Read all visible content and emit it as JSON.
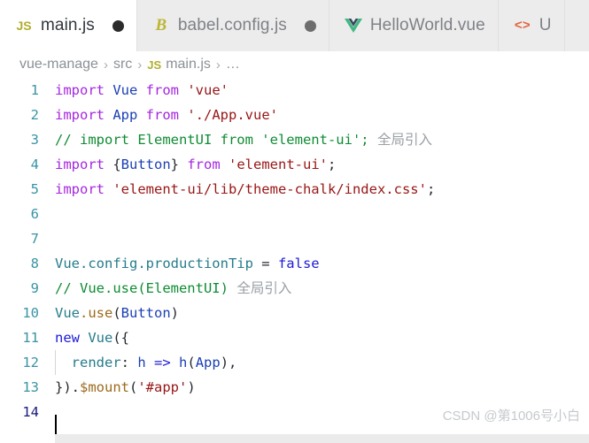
{
  "window": {
    "app": "visual-studio-code-editor",
    "active_file": "main.js"
  },
  "tabs": [
    {
      "label": "main.js",
      "icon": "js-file-icon",
      "icon_glyph": "JS",
      "active": true,
      "modified": true,
      "dot": "●"
    },
    {
      "label": "babel.config.js",
      "icon": "babel-file-icon",
      "icon_glyph": "B",
      "active": false,
      "modified": true,
      "dot": "●"
    },
    {
      "label": "HelloWorld.vue",
      "icon": "vue-file-icon",
      "icon_glyph": "V",
      "active": false,
      "modified": false,
      "dot": ""
    },
    {
      "label": "U",
      "icon": "html-file-icon",
      "icon_glyph": "<>",
      "active": false,
      "modified": false,
      "dot": ""
    }
  ],
  "breadcrumb": {
    "separator": "›",
    "items": [
      {
        "label": "vue-manage",
        "icon": ""
      },
      {
        "label": "src",
        "icon": ""
      },
      {
        "label": "main.js",
        "icon": "JS"
      },
      {
        "label": "…",
        "icon": ""
      }
    ]
  },
  "code": {
    "language": "javascript",
    "lines": [
      {
        "number": "1",
        "tokens": [
          {
            "text": "import ",
            "cls": "t-kw"
          },
          {
            "text": "Vue ",
            "cls": "t-id"
          },
          {
            "text": "from ",
            "cls": "t-kw"
          },
          {
            "text": "'vue'",
            "cls": "t-str"
          }
        ]
      },
      {
        "number": "2",
        "tokens": [
          {
            "text": "import ",
            "cls": "t-kw"
          },
          {
            "text": "App ",
            "cls": "t-id"
          },
          {
            "text": "from ",
            "cls": "t-kw"
          },
          {
            "text": "'./App.vue'",
            "cls": "t-str"
          }
        ]
      },
      {
        "number": "3",
        "tokens": [
          {
            "text": "// import ElementUI from 'element-ui'; ",
            "cls": "t-cmt"
          },
          {
            "text": "全局引入",
            "cls": "t-cmt-cn"
          }
        ]
      },
      {
        "number": "4",
        "tokens": [
          {
            "text": "import ",
            "cls": "t-kw"
          },
          {
            "text": "{",
            "cls": "t-punc"
          },
          {
            "text": "Button",
            "cls": "t-id"
          },
          {
            "text": "} ",
            "cls": "t-punc"
          },
          {
            "text": "from ",
            "cls": "t-kw"
          },
          {
            "text": "'element-ui'",
            "cls": "t-str"
          },
          {
            "text": ";",
            "cls": "t-punc"
          }
        ]
      },
      {
        "number": "5",
        "tokens": [
          {
            "text": "import ",
            "cls": "t-kw"
          },
          {
            "text": "'element-ui/lib/theme-chalk/index.css'",
            "cls": "t-str"
          },
          {
            "text": ";",
            "cls": "t-punc"
          }
        ]
      },
      {
        "number": "6",
        "tokens": []
      },
      {
        "number": "7",
        "tokens": []
      },
      {
        "number": "8",
        "tokens": [
          {
            "text": "Vue.config.productionTip ",
            "cls": "t-prop"
          },
          {
            "text": "= ",
            "cls": "t-punc"
          },
          {
            "text": "false",
            "cls": "t-kw2"
          }
        ]
      },
      {
        "number": "9",
        "tokens": [
          {
            "text": "// Vue.use(ElementUI) ",
            "cls": "t-cmt"
          },
          {
            "text": "全局引入",
            "cls": "t-cmt-cn"
          }
        ]
      },
      {
        "number": "10",
        "tokens": [
          {
            "text": "Vue",
            "cls": "t-prop"
          },
          {
            "text": ".use",
            "cls": "t-fn"
          },
          {
            "text": "(",
            "cls": "t-punc"
          },
          {
            "text": "Button",
            "cls": "t-id"
          },
          {
            "text": ")",
            "cls": "t-punc"
          }
        ]
      },
      {
        "number": "11",
        "tokens": [
          {
            "text": "new ",
            "cls": "t-kw2"
          },
          {
            "text": "Vue",
            "cls": "t-prop"
          },
          {
            "text": "({",
            "cls": "t-punc"
          }
        ]
      },
      {
        "number": "12",
        "indent_guide": true,
        "tokens": [
          {
            "text": "  ",
            "cls": "t-plain"
          },
          {
            "text": "render",
            "cls": "t-prop"
          },
          {
            "text": ": ",
            "cls": "t-punc"
          },
          {
            "text": "h ",
            "cls": "t-id"
          },
          {
            "text": "=> ",
            "cls": "t-kw2"
          },
          {
            "text": "h",
            "cls": "t-id"
          },
          {
            "text": "(",
            "cls": "t-punc"
          },
          {
            "text": "App",
            "cls": "t-id"
          },
          {
            "text": "),",
            "cls": "t-punc"
          }
        ]
      },
      {
        "number": "13",
        "tokens": [
          {
            "text": "}).",
            "cls": "t-punc"
          },
          {
            "text": "$mount",
            "cls": "t-fn"
          },
          {
            "text": "(",
            "cls": "t-punc"
          },
          {
            "text": "'#app'",
            "cls": "t-str"
          },
          {
            "text": ")",
            "cls": "t-punc"
          }
        ]
      },
      {
        "number": "14",
        "current": true,
        "caret": true,
        "tokens": []
      }
    ]
  },
  "watermark": {
    "text": "CSDN @第1006号小白"
  },
  "colors": {
    "keyword": "#a626e0",
    "keyword2": "#1b1bd6",
    "identifier": "#1b3fb5",
    "string": "#981616",
    "comment": "#0f8c33",
    "property": "#267c8c",
    "function": "#9c6a1c",
    "linenumber": "#3a94a5",
    "tabbar_bg": "#ececec",
    "editor_bg": "#ffffff"
  }
}
